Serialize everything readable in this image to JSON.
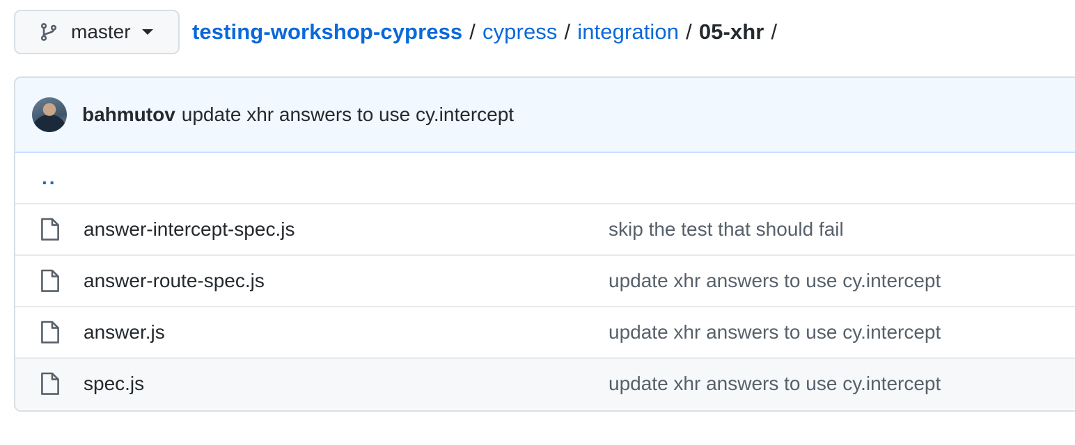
{
  "branch": {
    "label": "master",
    "icon": "git-branch-icon"
  },
  "breadcrumb": {
    "root": "testing-workshop-cypress",
    "sep": "/",
    "parts": [
      "cypress",
      "integration"
    ],
    "current": "05-xhr"
  },
  "latest_commit": {
    "author": "bahmutov",
    "message": "update xhr answers to use cy.intercept"
  },
  "parent_link": "..",
  "files": [
    {
      "name": "answer-intercept-spec.js",
      "message": "skip the test that should fail",
      "icon": "file-icon"
    },
    {
      "name": "answer-route-spec.js",
      "message": "update xhr answers to use cy.intercept",
      "icon": "file-icon"
    },
    {
      "name": "answer.js",
      "message": "update xhr answers to use cy.intercept",
      "icon": "file-icon"
    },
    {
      "name": "spec.js",
      "message": "update xhr answers to use cy.intercept",
      "icon": "file-icon"
    }
  ],
  "colors": {
    "link": "#0969da",
    "header_bg": "#f1f8ff",
    "muted": "#57606a"
  }
}
